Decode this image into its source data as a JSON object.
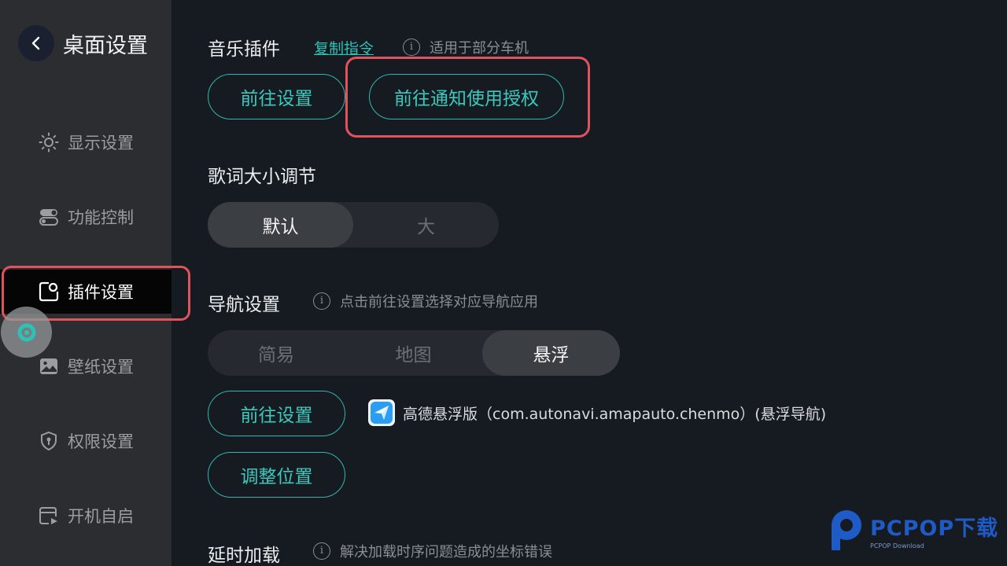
{
  "sidebar": {
    "title": "桌面设置",
    "items": [
      {
        "label": "显示设置",
        "icon": "sun-icon"
      },
      {
        "label": "功能控制",
        "icon": "toggle-icon"
      },
      {
        "label": "插件设置",
        "icon": "plugin-icon",
        "active": true
      },
      {
        "label": "壁纸设置",
        "icon": "image-icon"
      },
      {
        "label": "权限设置",
        "icon": "shield-icon"
      },
      {
        "label": "开机自启",
        "icon": "boot-icon"
      }
    ]
  },
  "music_plugin": {
    "title": "音乐插件",
    "copy_link": "复制指令",
    "hint": "适用于部分车机",
    "settings_btn": "前往设置",
    "notify_btn": "前往通知使用授权"
  },
  "lyrics": {
    "title": "歌词大小调节",
    "options": [
      "默认",
      "大"
    ],
    "selected": "默认"
  },
  "navigation": {
    "title": "导航设置",
    "hint": "点击前往设置选择对应导航应用",
    "options": [
      "简易",
      "地图",
      "悬浮"
    ],
    "selected": "悬浮",
    "settings_btn": "前往设置",
    "adjust_btn": "调整位置",
    "app_name": "高德悬浮版（com.autonavi.amapauto.chenmo）(悬浮导航)"
  },
  "delay_load": {
    "title": "延时加载",
    "hint": "解决加载时序问题造成的坐标错误"
  },
  "watermark": {
    "main": "PCPOP下载",
    "sub": "PCPOP Download"
  },
  "colors": {
    "accent": "#2fb8ad",
    "highlight": "#e0535c",
    "background": "#161b21",
    "sidebar": "#2b2d30"
  }
}
